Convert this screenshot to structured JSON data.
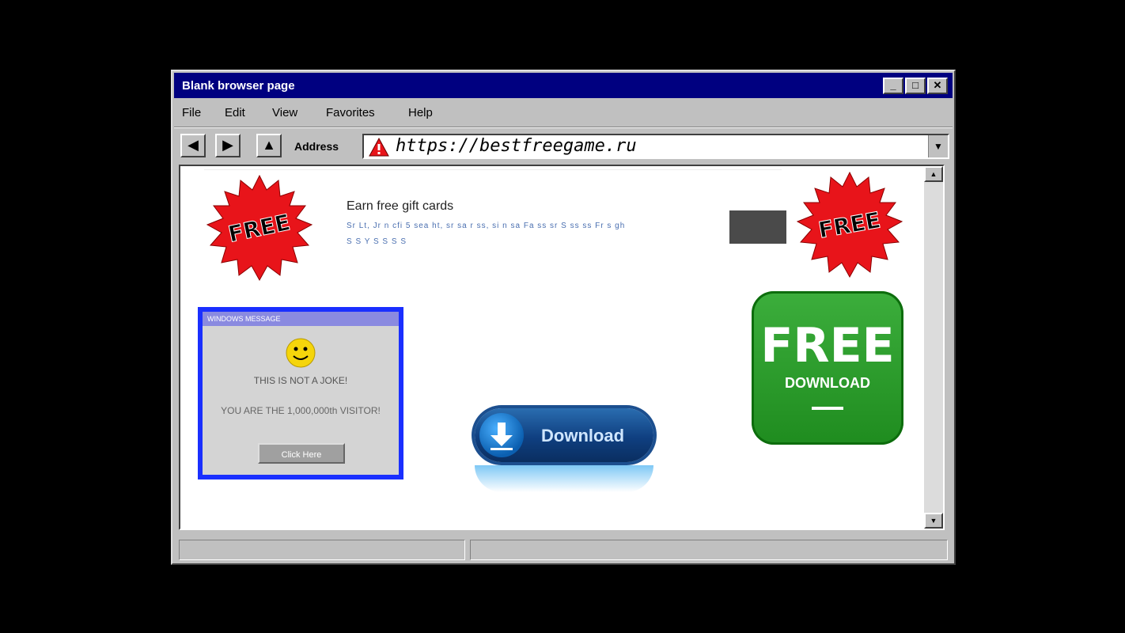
{
  "window": {
    "title": "Blank browser page",
    "controls": {
      "minimize": "_",
      "maximize": "□",
      "close": "✕"
    }
  },
  "menu": {
    "items": [
      "File",
      "Edit",
      "View",
      "Favorites",
      "Help"
    ]
  },
  "toolbar": {
    "back_icon": "back-arrow-icon",
    "forward_icon": "forward-arrow-icon",
    "home_icon": "home-icon",
    "address_label": "Address",
    "url": "https://bestfreegame.ru",
    "warning_icon": "warning-icon"
  },
  "content": {
    "ad_badge_left": "FREE",
    "ad_badge_right": "FREE",
    "ad_title": "Earn free gift cards",
    "ad_line1": "Sr Lt, Jr n cfi 5 sea ht, sr sa r ss, si n sa Fa ss sr S ss ss Fr s gh",
    "ad_line2": "S S Y S S S S",
    "popup": {
      "title": "WINDOWS MESSAGE",
      "line1": "THIS IS NOT A JOKE!",
      "line2": "YOU ARE THE 1,000,000th VISITOR!",
      "button": "Click Here"
    },
    "download_label": "Download",
    "green_big": "FREE",
    "green_small": "DOWNLOAD"
  },
  "colors": {
    "titlebar": "#000080",
    "popup_border": "#1a2fff",
    "starburst": "#e8141a",
    "green": "#2a9d2a"
  }
}
